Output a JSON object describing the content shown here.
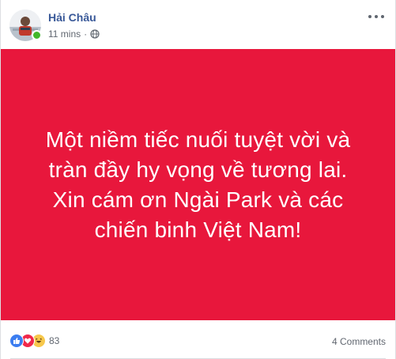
{
  "post": {
    "author": "Hải Châu",
    "timestamp": "11 mins",
    "separator": "·",
    "privacy_icon": "globe-icon",
    "body_lines": [
      "Một niềm tiếc nuối tuyệt vời và",
      "tràn đầy hy vọng về tương lai.",
      "Xin cám ơn Ngài Park và các",
      "chiến binh Việt Nam!"
    ],
    "banner_color": "#e8173c"
  },
  "footer": {
    "reaction_icons": [
      "like-icon",
      "love-icon",
      "haha-icon"
    ],
    "reaction_count": "83",
    "comments": "4 Comments"
  },
  "colors": {
    "author_link": "#385898",
    "meta_text": "#616770",
    "online": "#42b72a"
  }
}
